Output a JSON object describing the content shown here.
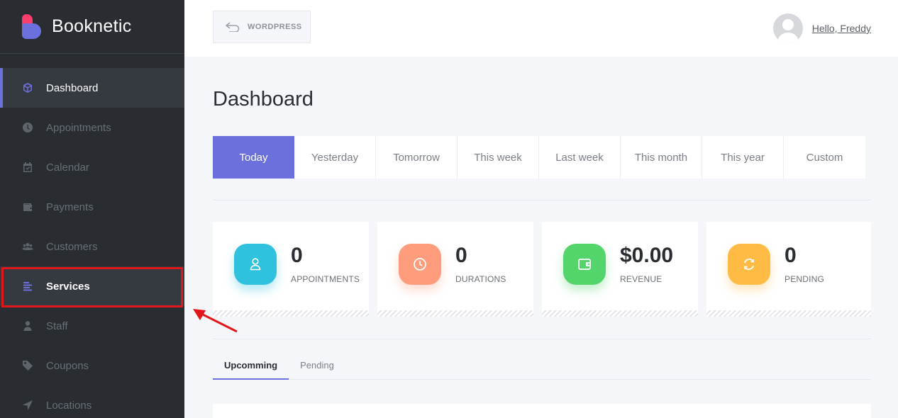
{
  "brand": {
    "name": "Booknetic"
  },
  "sidebar": {
    "items": [
      {
        "label": "Dashboard",
        "icon": "cube-icon"
      },
      {
        "label": "Appointments",
        "icon": "clock-icon"
      },
      {
        "label": "Calendar",
        "icon": "calendar-icon"
      },
      {
        "label": "Payments",
        "icon": "wallet-icon"
      },
      {
        "label": "Customers",
        "icon": "users-icon"
      },
      {
        "label": "Services",
        "icon": "list-icon"
      },
      {
        "label": "Staff",
        "icon": "user-icon"
      },
      {
        "label": "Coupons",
        "icon": "tag-icon"
      },
      {
        "label": "Locations",
        "icon": "location-arrow-icon"
      }
    ]
  },
  "header": {
    "wordpress_label": "WORDPRESS",
    "user_greeting": "Hello, Freddy"
  },
  "main": {
    "title": "Dashboard",
    "filters": [
      "Today",
      "Yesterday",
      "Tomorrow",
      "This week",
      "Last week",
      "This month",
      "This year",
      "Custom"
    ],
    "active_filter": "Today",
    "stats": [
      {
        "value": "0",
        "label": "APPOINTMENTS",
        "color": "#2fc1dd",
        "icon": "user-icon"
      },
      {
        "value": "0",
        "label": "DURATIONS",
        "color": "#ff9c7b",
        "icon": "clock-icon"
      },
      {
        "value": "$0.00",
        "label": "REVENUE",
        "color": "#53d56c",
        "icon": "wallet-icon"
      },
      {
        "value": "0",
        "label": "PENDING",
        "color": "#ffbb44",
        "icon": "refresh-icon"
      }
    ],
    "tabs": [
      "Upcomming",
      "Pending"
    ],
    "active_tab": "Upcomming"
  },
  "colors": {
    "accent": "#6c70dc",
    "sidebar_bg": "#292d32",
    "highlight_annotation": "#e0161b"
  }
}
